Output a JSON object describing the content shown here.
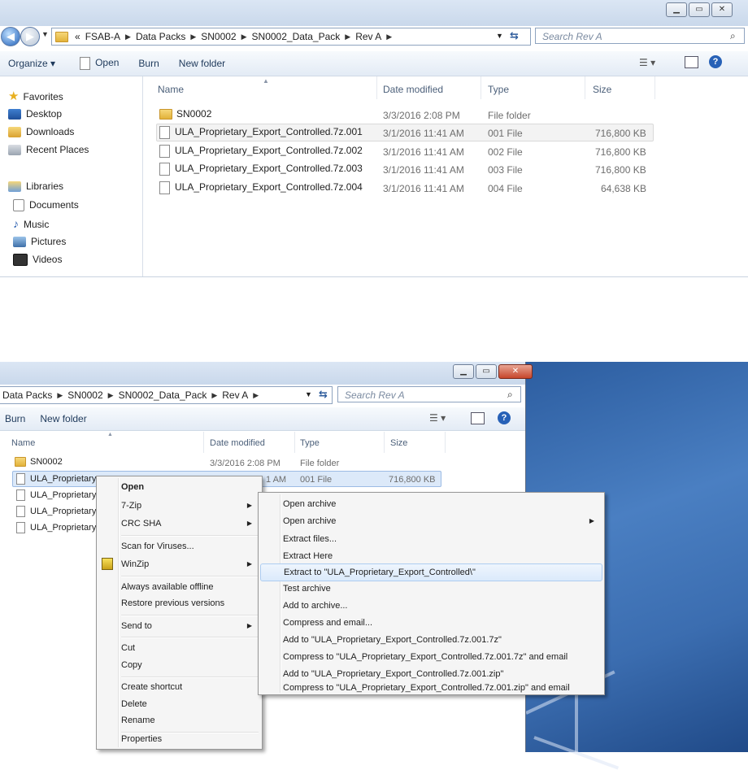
{
  "top": {
    "address": [
      "«",
      "FSAB-A",
      "Data Packs",
      "SN0002",
      "SN0002_Data_Pack",
      "Rev A"
    ],
    "search_placeholder": "Search Rev A",
    "toolbar": {
      "organize": "Organize ▾",
      "open": "Open",
      "burn": "Burn",
      "new_folder": "New folder"
    },
    "nav": {
      "favorites": "Favorites",
      "desktop": "Desktop",
      "downloads": "Downloads",
      "recent": "Recent Places",
      "libraries": "Libraries",
      "documents": "Documents",
      "music": "Music",
      "pictures": "Pictures",
      "videos": "Videos"
    },
    "columns": {
      "name": "Name",
      "date": "Date modified",
      "type": "Type",
      "size": "Size"
    },
    "rows": [
      {
        "name": "SN0002",
        "date": "3/3/2016 2:08 PM",
        "type": "File folder",
        "size": ""
      },
      {
        "name": "ULA_Proprietary_Export_Controlled.7z.001",
        "date": "3/1/2016 11:41 AM",
        "type": "001 File",
        "size": "716,800 KB"
      },
      {
        "name": "ULA_Proprietary_Export_Controlled.7z.002",
        "date": "3/1/2016 11:41 AM",
        "type": "002 File",
        "size": "716,800 KB"
      },
      {
        "name": "ULA_Proprietary_Export_Controlled.7z.003",
        "date": "3/1/2016 11:41 AM",
        "type": "003 File",
        "size": "716,800 KB"
      },
      {
        "name": "ULA_Proprietary_Export_Controlled.7z.004",
        "date": "3/1/2016 11:41 AM",
        "type": "004 File",
        "size": "64,638 KB"
      }
    ]
  },
  "bottom": {
    "address": [
      "Data Packs",
      "SN0002",
      "SN0002_Data_Pack",
      "Rev A"
    ],
    "search_placeholder": "Search Rev A",
    "toolbar": {
      "burn": "Burn",
      "new_folder": "New folder"
    },
    "columns": {
      "name": "Name",
      "date": "Date modified",
      "type": "Type",
      "size": "Size"
    },
    "rows": [
      {
        "name": "SN0002",
        "date": "3/3/2016 2:08 PM",
        "type": "File folder",
        "size": ""
      },
      {
        "name": "ULA_Proprietary_",
        "date": "1 AM",
        "type": "001 File",
        "size": "716,800 KB"
      },
      {
        "name": "ULA_Proprietary_"
      },
      {
        "name": "ULA_Proprietary_"
      },
      {
        "name": "ULA_Proprietary_"
      }
    ]
  },
  "context_menu": {
    "open": "Open",
    "seven_zip": "7-Zip",
    "crc_sha": "CRC SHA",
    "scan": "Scan for Viruses...",
    "winzip": "WinZip",
    "offline": "Always available offline",
    "restore": "Restore previous versions",
    "send_to": "Send to",
    "cut": "Cut",
    "copy": "Copy",
    "shortcut": "Create shortcut",
    "delete": "Delete",
    "rename": "Rename",
    "properties": "Properties"
  },
  "seven_zip_menu": {
    "open_archive": "Open archive",
    "open_archive_sub": "Open archive",
    "extract_files": "Extract files...",
    "extract_here": "Extract Here",
    "extract_to": "Extract to \"ULA_Proprietary_Export_Controlled\\\"",
    "test": "Test archive",
    "add": "Add to archive...",
    "compress_email": "Compress and email...",
    "add_7z": "Add to \"ULA_Proprietary_Export_Controlled.7z.001.7z\"",
    "compress_7z_email": "Compress to \"ULA_Proprietary_Export_Controlled.7z.001.7z\" and email",
    "add_zip": "Add to \"ULA_Proprietary_Export_Controlled.7z.001.zip\"",
    "compress_zip_email": "Compress to \"ULA_Proprietary_Export_Controlled.7z.001.zip\" and email"
  },
  "colors": {
    "selection": "#dce9f9",
    "menu_highlight": "#dbeafb",
    "accent": "#1e395b"
  }
}
